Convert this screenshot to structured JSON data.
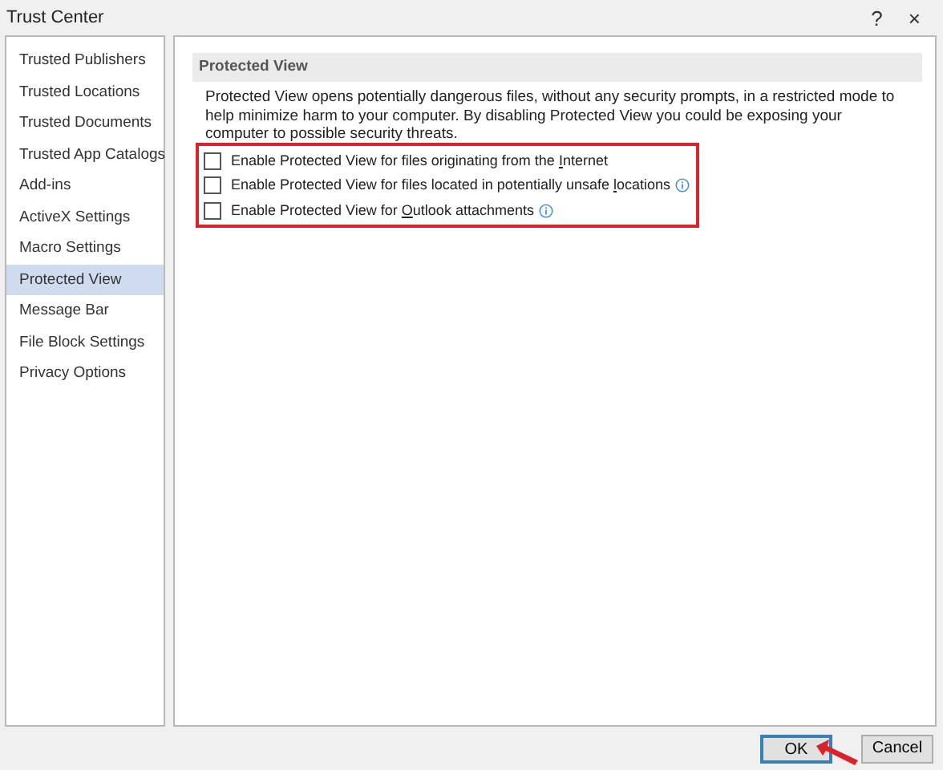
{
  "window": {
    "title": "Trust Center",
    "help": "?",
    "close": "×"
  },
  "sidebar": {
    "items": [
      {
        "label": "Trusted Publishers",
        "selected": false
      },
      {
        "label": "Trusted Locations",
        "selected": false
      },
      {
        "label": "Trusted Documents",
        "selected": false
      },
      {
        "label": "Trusted App Catalogs",
        "selected": false
      },
      {
        "label": "Add-ins",
        "selected": false
      },
      {
        "label": "ActiveX Settings",
        "selected": false
      },
      {
        "label": "Macro Settings",
        "selected": false
      },
      {
        "label": "Protected View",
        "selected": true
      },
      {
        "label": "Message Bar",
        "selected": false
      },
      {
        "label": "File Block Settings",
        "selected": false
      },
      {
        "label": "Privacy Options",
        "selected": false
      }
    ]
  },
  "section": {
    "title": "Protected View",
    "description": "Protected View opens potentially dangerous files, without any security prompts, in a restricted mode to help minimize harm to your computer. By disabling Protected View you could be exposing your computer to possible security threats.",
    "options": [
      {
        "label_before": "Enable Protected View for files originating from the ",
        "access_key": "I",
        "label_after": "nternet",
        "checked": false,
        "info": false
      },
      {
        "label_before": "Enable Protected View for files located in potentially unsafe ",
        "access_key": "l",
        "label_after": "ocations",
        "checked": false,
        "info": true
      },
      {
        "label_before": "Enable Protected View for ",
        "access_key": "O",
        "label_after": "utlook attachments",
        "checked": false,
        "info": true
      }
    ]
  },
  "buttons": [
    {
      "label": "OK",
      "default": true
    },
    {
      "label": "Cancel",
      "default": false
    }
  ]
}
